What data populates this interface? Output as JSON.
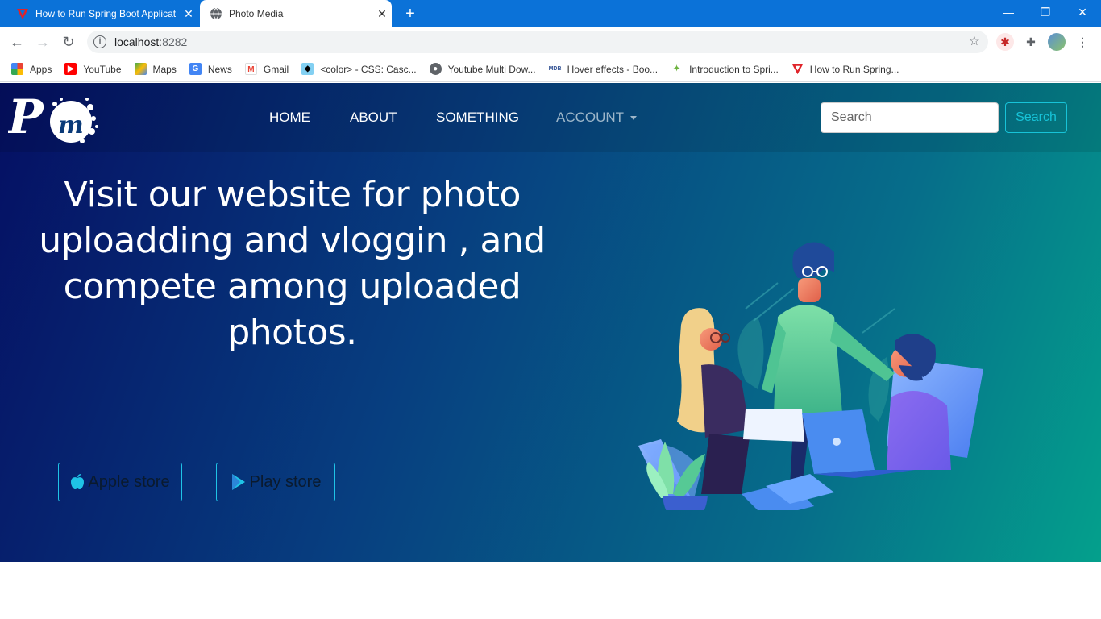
{
  "browser": {
    "tabs": [
      {
        "title": "How to Run Spring Boot Applicat",
        "active": false,
        "favicon": "red-v-icon"
      },
      {
        "title": "Photo Media",
        "active": true,
        "favicon": "globe-icon"
      }
    ],
    "new_tab": "+",
    "window_controls": {
      "minimize": "—",
      "restore": "❐",
      "close": "✕"
    },
    "url_host": "localhost",
    "url_port": ":8282",
    "bookmarks": [
      {
        "label": "Apps",
        "icon": "apps-grid-icon"
      },
      {
        "label": "YouTube",
        "icon": "youtube-icon"
      },
      {
        "label": "Maps",
        "icon": "maps-icon"
      },
      {
        "label": "News",
        "icon": "news-icon"
      },
      {
        "label": "Gmail",
        "icon": "gmail-icon"
      },
      {
        "label": "<color> - CSS: Casc...",
        "icon": "mdn-icon"
      },
      {
        "label": "Youtube Multi Dow...",
        "icon": "globe-icon"
      },
      {
        "label": "Hover effects - Boo...",
        "icon": "mdb-icon"
      },
      {
        "label": "Introduction to Spri...",
        "icon": "spring-icon"
      },
      {
        "label": "How to Run Spring...",
        "icon": "red-v-icon"
      }
    ]
  },
  "site": {
    "logo_text": "Pm",
    "nav": [
      {
        "label": "HOME"
      },
      {
        "label": "ABOUT"
      },
      {
        "label": "SOMETHING"
      },
      {
        "label": "ACCOUNT",
        "dropdown": true
      }
    ],
    "search": {
      "placeholder": "Search",
      "button": "Search"
    },
    "headline": "Visit our website for photo uploadding and vloggin , and compete among uploaded photos.",
    "stores": [
      {
        "label": "Apple store",
        "icon": "apple-icon"
      },
      {
        "label": "Play store",
        "icon": "play-store-icon"
      }
    ],
    "colors": {
      "accent": "#17c3d8",
      "gradient_start": "#050f63",
      "gradient_end": "#04a08c"
    }
  }
}
